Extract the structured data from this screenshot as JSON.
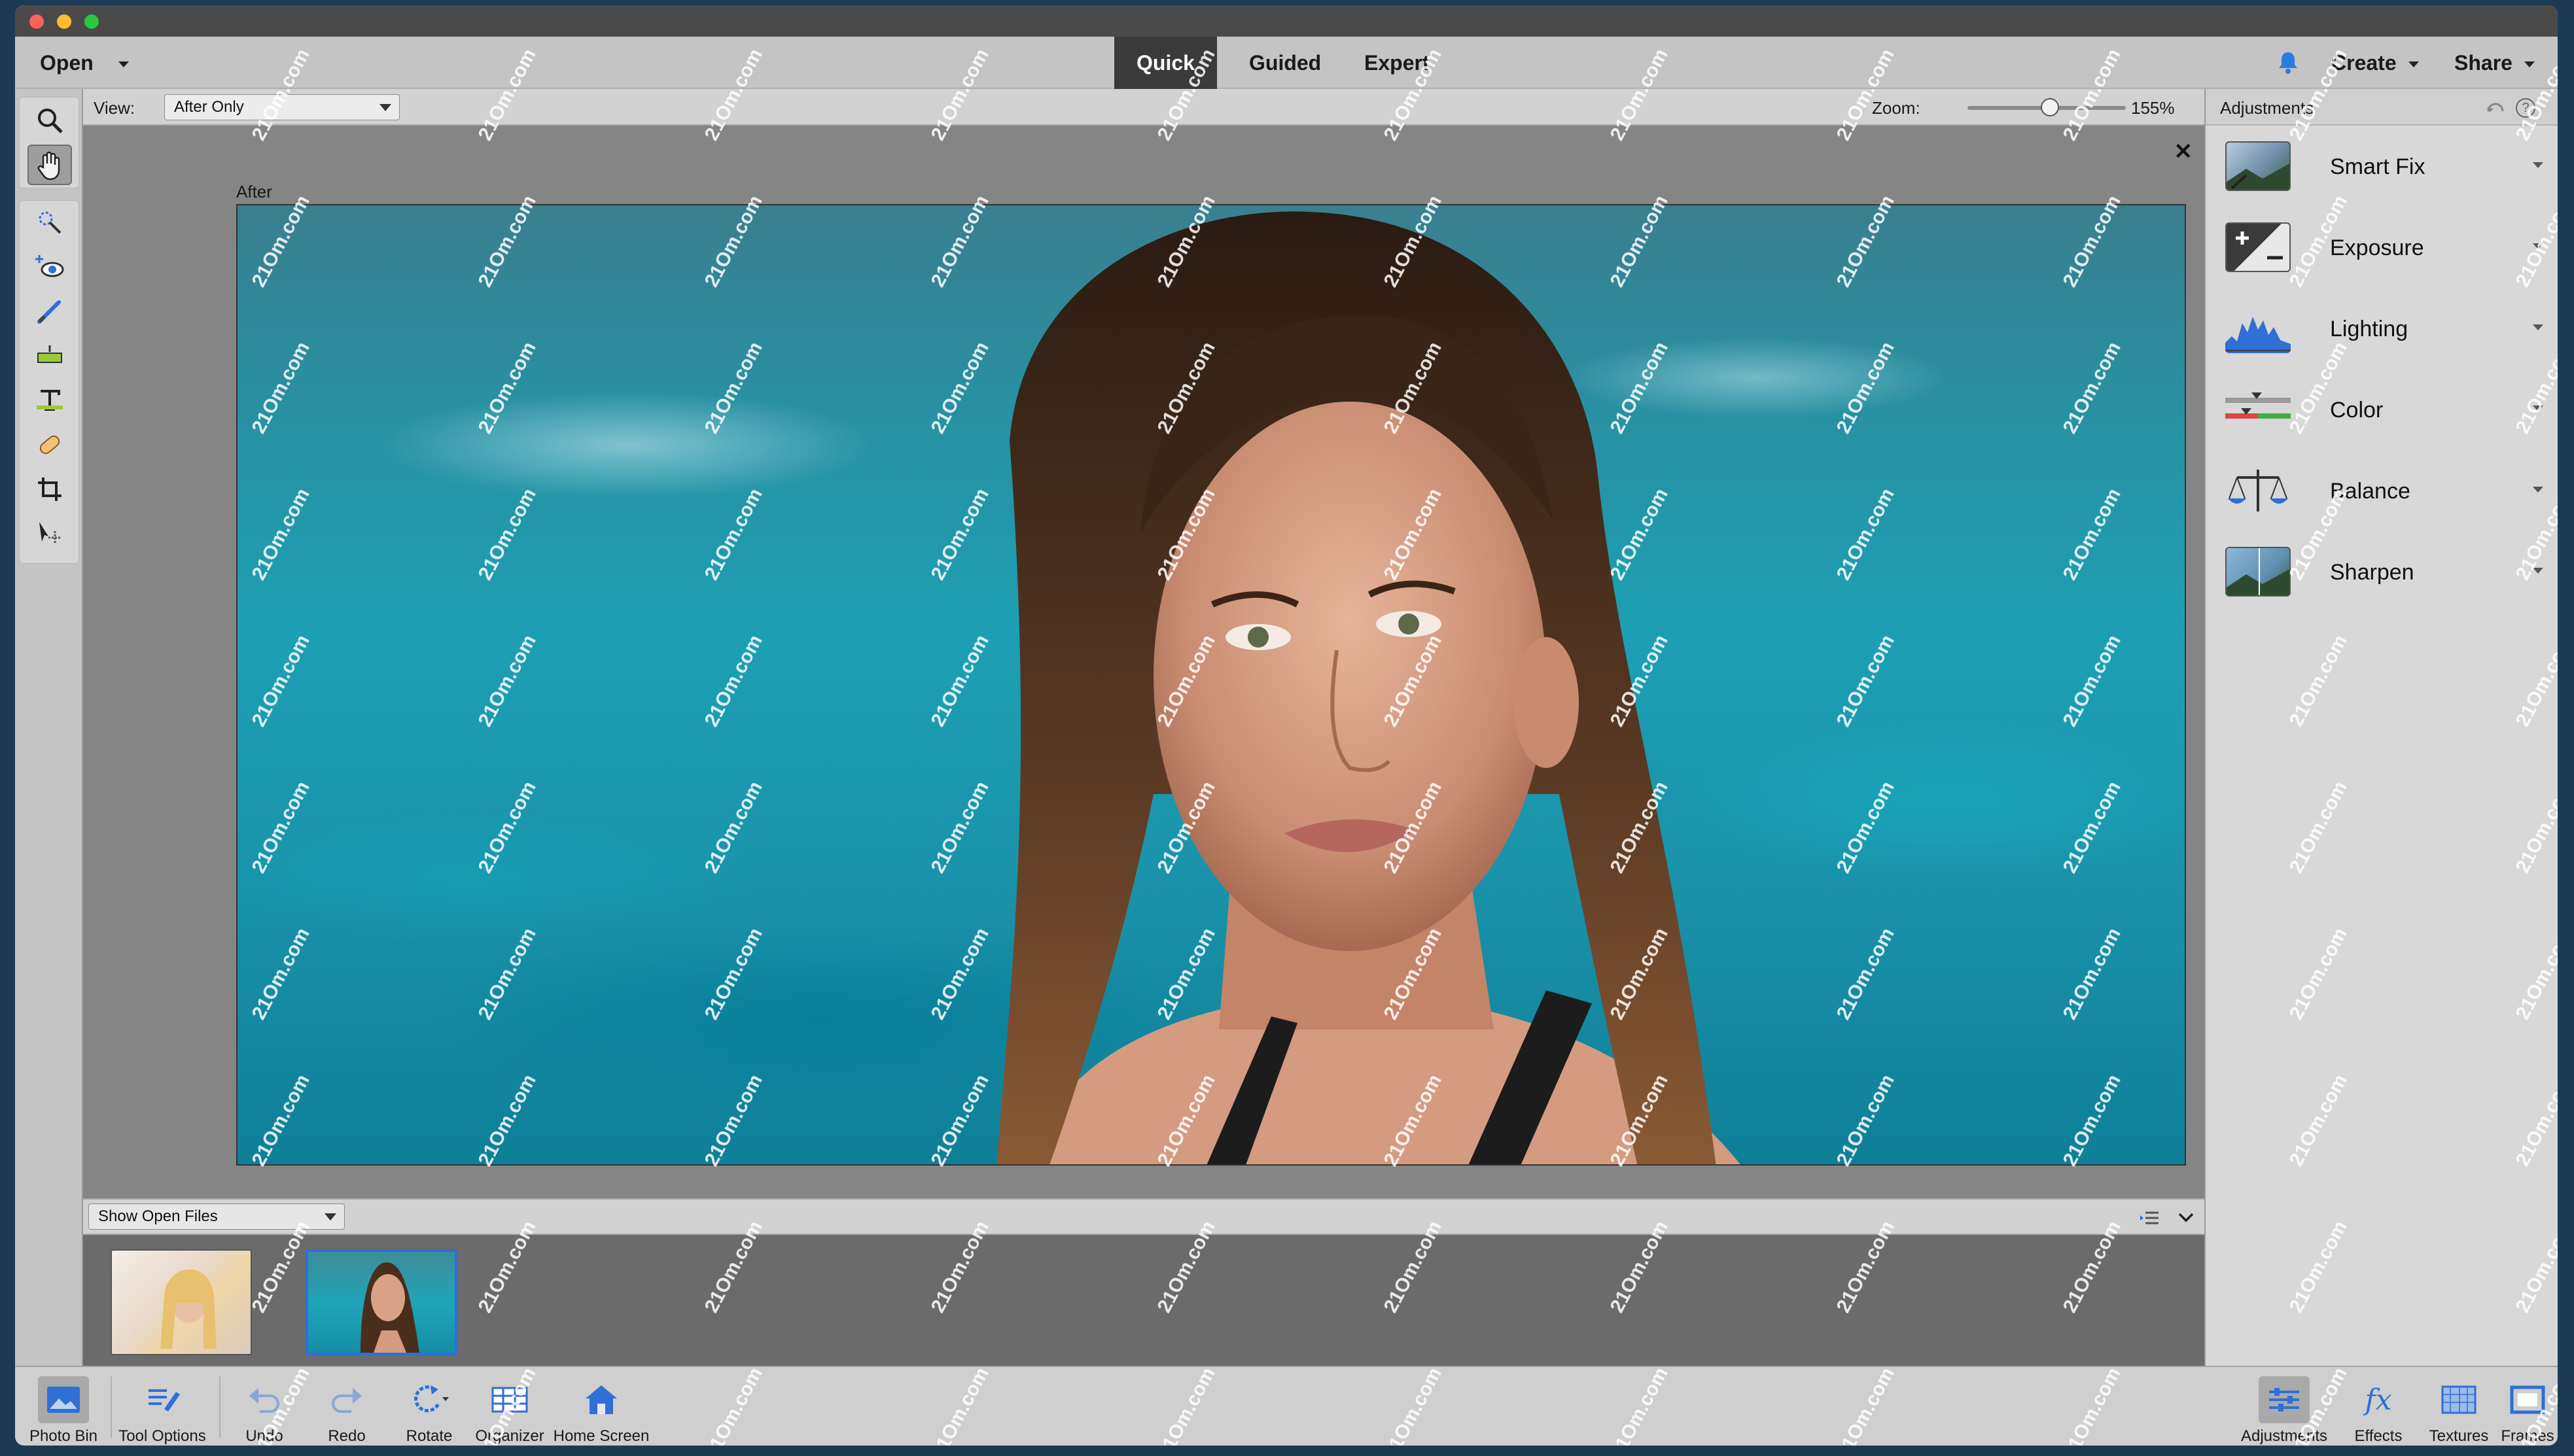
{
  "menubar": {
    "open_label": "Open",
    "modes": [
      "Quick",
      "Guided",
      "Expert"
    ],
    "create_label": "Create",
    "share_label": "Share"
  },
  "options": {
    "view_label": "View:",
    "view_value": "After Only",
    "zoom_label": "Zoom:",
    "zoom_value": "155%",
    "zoom_level_fraction": 0.52
  },
  "canvas": {
    "caption": "After"
  },
  "photo_bin": {
    "filter_value": "Show Open Files"
  },
  "right_panel": {
    "title": "Adjustments",
    "items": [
      "Smart Fix",
      "Exposure",
      "Lighting",
      "Color",
      "Balance",
      "Sharpen"
    ]
  },
  "bottom_bar": {
    "left": [
      "Photo Bin",
      "Tool Options",
      "Undo",
      "Redo",
      "Rotate",
      "Organizer",
      "Home Screen"
    ],
    "right": [
      "Adjustments",
      "Effects",
      "Textures",
      "Frames"
    ]
  },
  "watermark": "21Om.com",
  "colors": {
    "active_mode_bg": "#3a3a3a",
    "accent_blue": "#2f6fd6",
    "notification_blue": "#2a7be4"
  }
}
